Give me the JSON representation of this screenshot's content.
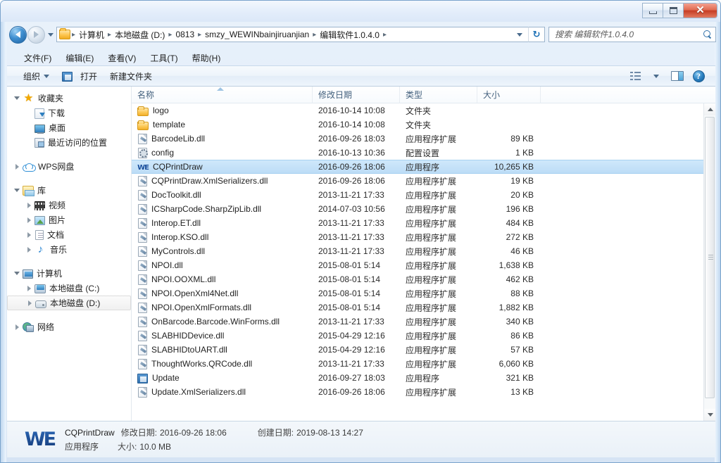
{
  "window": {
    "controls": {
      "minimize": "Minimize",
      "maximize": "Maximize",
      "close": "Close",
      "close_glyph": "✕"
    }
  },
  "address_bar": {
    "back_label": "后退",
    "forward_label": "前进",
    "history_label": "最近浏览的位置",
    "refresh_label": "刷新",
    "refresh_glyph": "↻",
    "breadcrumbs": [
      "计算机",
      "本地磁盘 (D:)",
      "0813",
      "smzy_WEWINbainjiruanjian",
      "编辑软件1.0.4.0"
    ],
    "separator": "▸"
  },
  "search": {
    "placeholder": "搜索 编辑软件1.0.4.0",
    "value": ""
  },
  "menu": {
    "items": [
      "文件(F)",
      "编辑(E)",
      "查看(V)",
      "工具(T)",
      "帮助(H)"
    ]
  },
  "toolbar": {
    "organize_label": "组织",
    "open_label": "打开",
    "new_folder_label": "新建文件夹",
    "view_label": "更改您的视图",
    "preview_label": "显示预览窗格",
    "help_label": "帮助",
    "help_glyph": "?"
  },
  "nav_pane": {
    "nodes": [
      {
        "label": "收藏夹",
        "depth": 0,
        "twisty": "expanded",
        "icon": "favorites-star-icon",
        "selected": false
      },
      {
        "label": "下载",
        "depth": 1,
        "twisty": "none",
        "icon": "downloads-icon",
        "selected": false
      },
      {
        "label": "桌面",
        "depth": 1,
        "twisty": "none",
        "icon": "desktop-icon",
        "selected": false
      },
      {
        "label": "最近访问的位置",
        "depth": 1,
        "twisty": "none",
        "icon": "recent-places-icon",
        "selected": false
      },
      {
        "gap": true
      },
      {
        "label": "WPS网盘",
        "depth": 0,
        "twisty": "collapsed",
        "icon": "cloud-icon",
        "selected": false
      },
      {
        "gap": true
      },
      {
        "label": "库",
        "depth": 0,
        "twisty": "expanded",
        "icon": "library-icon",
        "selected": false
      },
      {
        "label": "视频",
        "depth": 1,
        "twisty": "collapsed",
        "icon": "video-icon",
        "selected": false
      },
      {
        "label": "图片",
        "depth": 1,
        "twisty": "collapsed",
        "icon": "picture-icon",
        "selected": false
      },
      {
        "label": "文档",
        "depth": 1,
        "twisty": "collapsed",
        "icon": "document-icon",
        "selected": false
      },
      {
        "label": "音乐",
        "depth": 1,
        "twisty": "collapsed",
        "icon": "music-icon",
        "selected": false
      },
      {
        "gap": true
      },
      {
        "label": "计算机",
        "depth": 0,
        "twisty": "expanded",
        "icon": "computer-icon",
        "selected": false
      },
      {
        "label": "本地磁盘 (C:)",
        "depth": 1,
        "twisty": "collapsed",
        "icon": "drive-c-icon",
        "selected": false
      },
      {
        "label": "本地磁盘 (D:)",
        "depth": 1,
        "twisty": "collapsed",
        "icon": "drive-d-icon",
        "selected": true
      },
      {
        "gap": true
      },
      {
        "label": "网络",
        "depth": 0,
        "twisty": "collapsed",
        "icon": "network-icon",
        "selected": false
      }
    ]
  },
  "file_list": {
    "columns": [
      "名称",
      "修改日期",
      "类型",
      "大小"
    ],
    "sort_column": "名称",
    "sort_direction": "ascending",
    "rows": [
      {
        "name": "logo",
        "date": "2016-10-14 10:08",
        "type": "文件夹",
        "size": "",
        "icon": "folder-icon",
        "selected": false
      },
      {
        "name": "template",
        "date": "2016-10-14 10:08",
        "type": "文件夹",
        "size": "",
        "icon": "folder-icon",
        "selected": false
      },
      {
        "name": "BarcodeLib.dll",
        "date": "2016-09-26 18:03",
        "type": "应用程序扩展",
        "size": "89 KB",
        "icon": "dll-icon",
        "selected": false
      },
      {
        "name": "config",
        "date": "2016-10-13 10:36",
        "type": "配置设置",
        "size": "1 KB",
        "icon": "config-icon",
        "selected": false
      },
      {
        "name": "CQPrintDraw",
        "date": "2016-09-26 18:06",
        "type": "应用程序",
        "size": "10,265 KB",
        "icon": "we-app-icon",
        "selected": true
      },
      {
        "name": "CQPrintDraw.XmlSerializers.dll",
        "date": "2016-09-26 18:06",
        "type": "应用程序扩展",
        "size": "19 KB",
        "icon": "dll-icon",
        "selected": false
      },
      {
        "name": "DocToolkit.dll",
        "date": "2013-11-21 17:33",
        "type": "应用程序扩展",
        "size": "20 KB",
        "icon": "dll-icon",
        "selected": false
      },
      {
        "name": "ICSharpCode.SharpZipLib.dll",
        "date": "2014-07-03 10:56",
        "type": "应用程序扩展",
        "size": "196 KB",
        "icon": "dll-icon",
        "selected": false
      },
      {
        "name": "Interop.ET.dll",
        "date": "2013-11-21 17:33",
        "type": "应用程序扩展",
        "size": "484 KB",
        "icon": "dll-icon",
        "selected": false
      },
      {
        "name": "Interop.KSO.dll",
        "date": "2013-11-21 17:33",
        "type": "应用程序扩展",
        "size": "272 KB",
        "icon": "dll-icon",
        "selected": false
      },
      {
        "name": "MyControls.dll",
        "date": "2013-11-21 17:33",
        "type": "应用程序扩展",
        "size": "46 KB",
        "icon": "dll-icon",
        "selected": false
      },
      {
        "name": "NPOI.dll",
        "date": "2015-08-01 5:14",
        "type": "应用程序扩展",
        "size": "1,638 KB",
        "icon": "dll-icon",
        "selected": false
      },
      {
        "name": "NPOI.OOXML.dll",
        "date": "2015-08-01 5:14",
        "type": "应用程序扩展",
        "size": "462 KB",
        "icon": "dll-icon",
        "selected": false
      },
      {
        "name": "NPOI.OpenXml4Net.dll",
        "date": "2015-08-01 5:14",
        "type": "应用程序扩展",
        "size": "88 KB",
        "icon": "dll-icon",
        "selected": false
      },
      {
        "name": "NPOI.OpenXmlFormats.dll",
        "date": "2015-08-01 5:14",
        "type": "应用程序扩展",
        "size": "1,882 KB",
        "icon": "dll-icon",
        "selected": false
      },
      {
        "name": "OnBarcode.Barcode.WinForms.dll",
        "date": "2013-11-21 17:33",
        "type": "应用程序扩展",
        "size": "340 KB",
        "icon": "dll-icon",
        "selected": false
      },
      {
        "name": "SLABHIDDevice.dll",
        "date": "2015-04-29 12:16",
        "type": "应用程序扩展",
        "size": "86 KB",
        "icon": "dll-icon",
        "selected": false
      },
      {
        "name": "SLABHIDtoUART.dll",
        "date": "2015-04-29 12:16",
        "type": "应用程序扩展",
        "size": "57 KB",
        "icon": "dll-icon",
        "selected": false
      },
      {
        "name": "ThoughtWorks.QRCode.dll",
        "date": "2013-11-21 17:33",
        "type": "应用程序扩展",
        "size": "6,060 KB",
        "icon": "dll-icon",
        "selected": false
      },
      {
        "name": "Update",
        "date": "2016-09-27 18:03",
        "type": "应用程序",
        "size": "321 KB",
        "icon": "update-app-icon",
        "selected": false
      },
      {
        "name": "Update.XmlSerializers.dll",
        "date": "2016-09-26 18:06",
        "type": "应用程序扩展",
        "size": "13 KB",
        "icon": "dll-icon",
        "selected": false
      }
    ]
  },
  "details_pane": {
    "icon_text": "WE",
    "file_name": "CQPrintDraw",
    "file_type": "应用程序",
    "modified_key": "修改日期:",
    "modified_value": "2016-09-26 18:06",
    "created_key": "创建日期:",
    "created_value": "2019-08-13 14:27",
    "size_key": "大小:",
    "size_value": "10.0 MB"
  },
  "colors": {
    "selection_blue": "#bcdcf6",
    "frame_blue": "#d6e4f4",
    "close_red": "#c63d24",
    "accent_text": "#43607d"
  }
}
